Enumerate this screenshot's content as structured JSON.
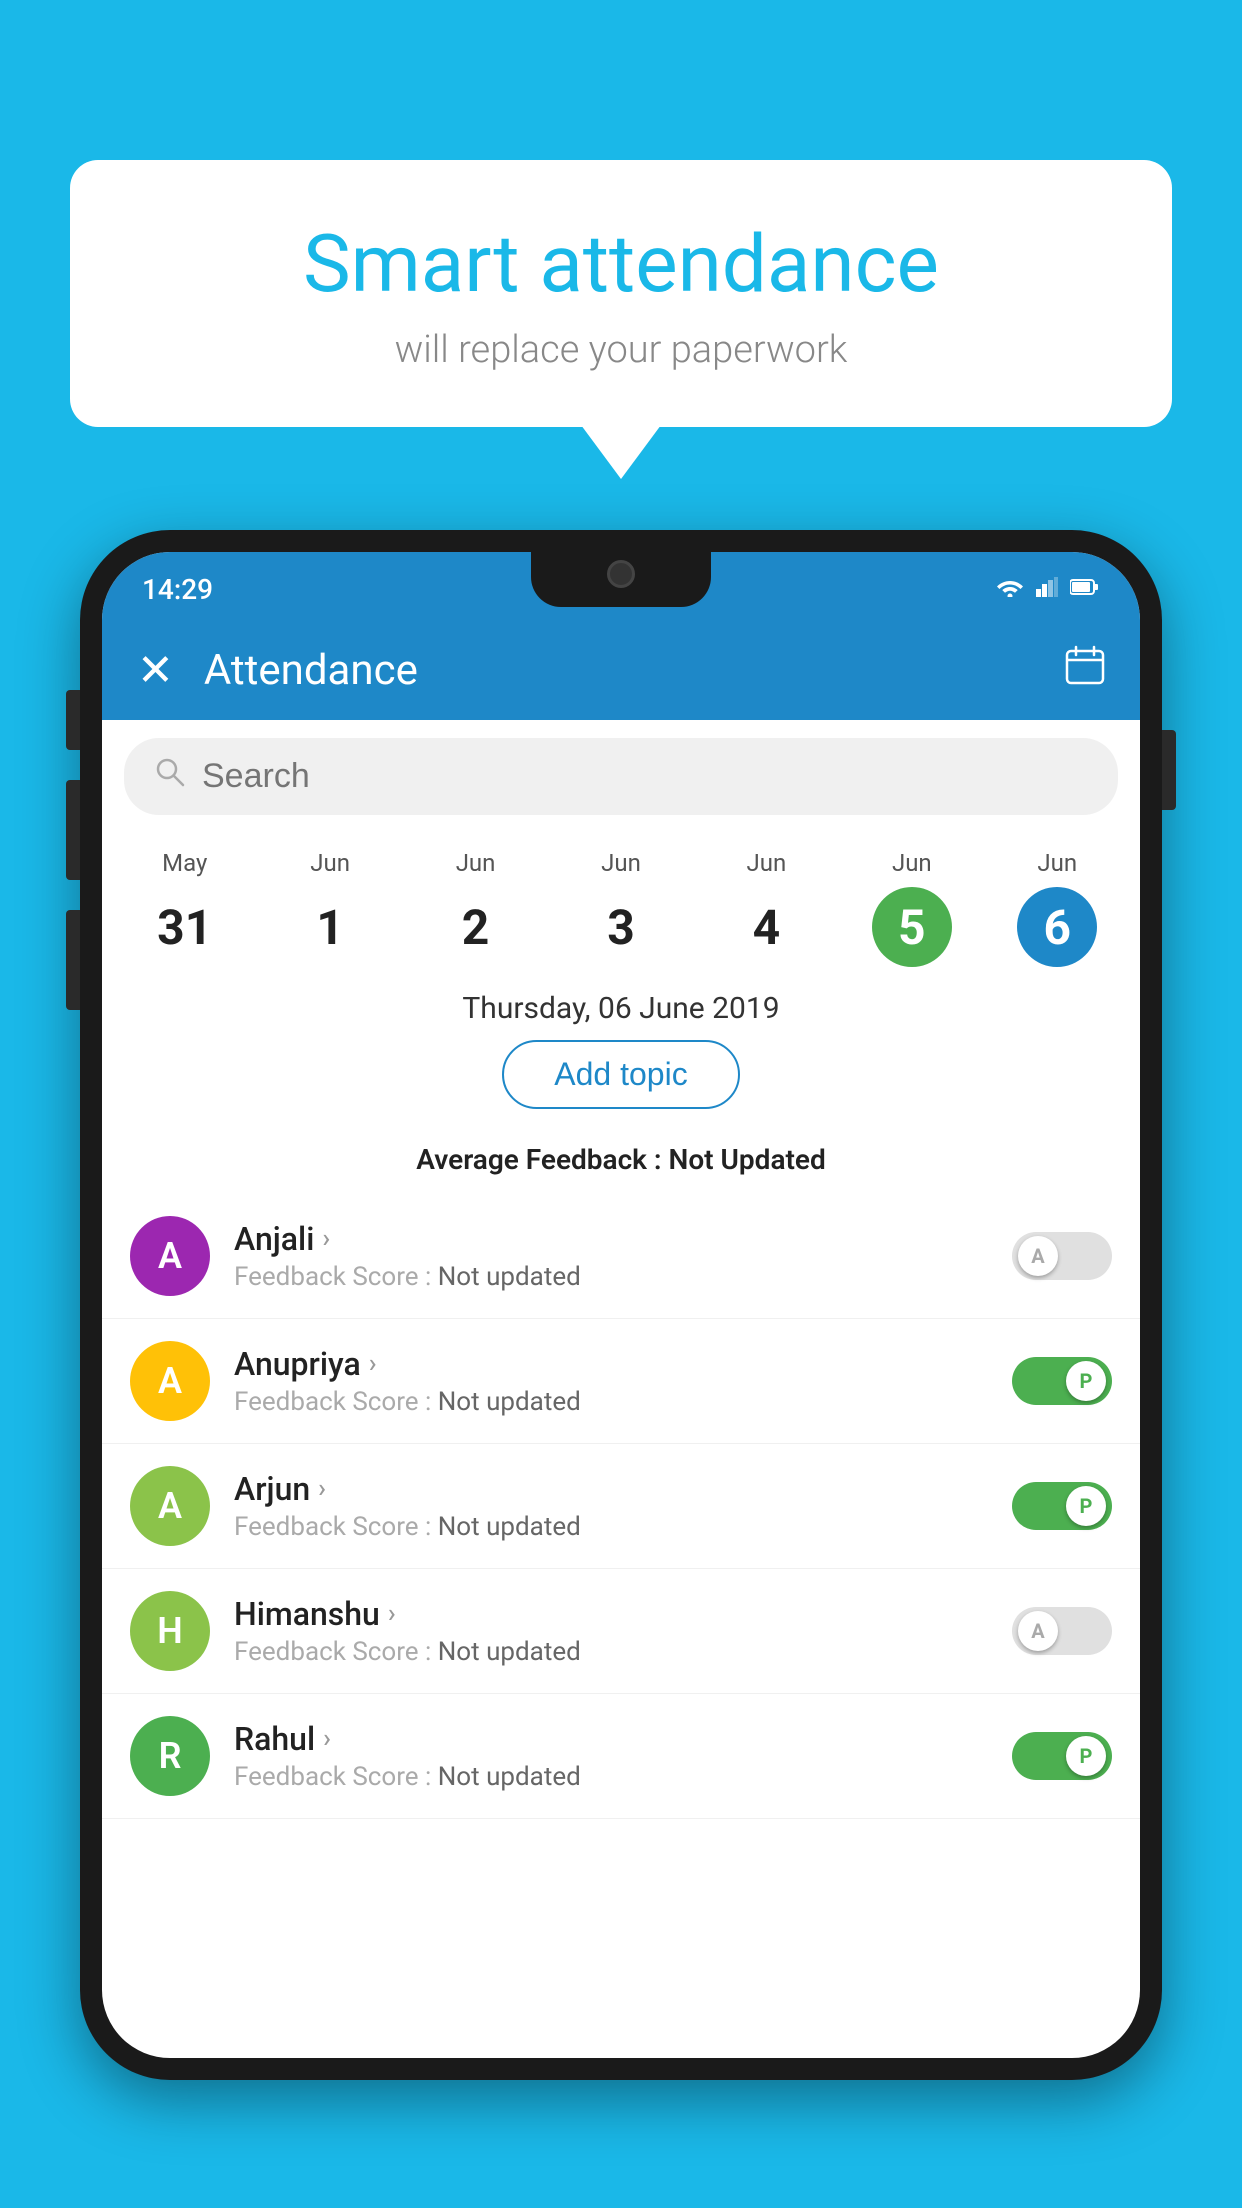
{
  "background_color": "#1ab8e8",
  "speech_bubble": {
    "title": "Smart attendance",
    "subtitle": "will replace your paperwork"
  },
  "status_bar": {
    "time": "14:29",
    "wifi": "▼",
    "signal": "▲",
    "battery": "▌"
  },
  "app_bar": {
    "title": "Attendance",
    "close_label": "✕",
    "calendar_icon": "📅"
  },
  "search": {
    "placeholder": "Search"
  },
  "calendar": {
    "days": [
      {
        "month": "May",
        "date": "31",
        "state": "normal"
      },
      {
        "month": "Jun",
        "date": "1",
        "state": "normal"
      },
      {
        "month": "Jun",
        "date": "2",
        "state": "normal"
      },
      {
        "month": "Jun",
        "date": "3",
        "state": "normal"
      },
      {
        "month": "Jun",
        "date": "4",
        "state": "normal"
      },
      {
        "month": "Jun",
        "date": "5",
        "state": "today"
      },
      {
        "month": "Jun",
        "date": "6",
        "state": "selected"
      }
    ]
  },
  "selected_date": "Thursday, 06 June 2019",
  "add_topic_label": "Add topic",
  "average_feedback": {
    "label": "Average Feedback : ",
    "value": "Not Updated"
  },
  "students": [
    {
      "name": "Anjali",
      "avatar_letter": "A",
      "avatar_color": "#9c27b0",
      "feedback_label": "Feedback Score : ",
      "feedback_value": "Not updated",
      "toggle_state": "off",
      "toggle_label": "A"
    },
    {
      "name": "Anupriya",
      "avatar_letter": "A",
      "avatar_color": "#ffc107",
      "feedback_label": "Feedback Score : ",
      "feedback_value": "Not updated",
      "toggle_state": "on",
      "toggle_label": "P"
    },
    {
      "name": "Arjun",
      "avatar_letter": "A",
      "avatar_color": "#8bc34a",
      "feedback_label": "Feedback Score : ",
      "feedback_value": "Not updated",
      "toggle_state": "on",
      "toggle_label": "P"
    },
    {
      "name": "Himanshu",
      "avatar_letter": "H",
      "avatar_color": "#8bc34a",
      "feedback_label": "Feedback Score : ",
      "feedback_value": "Not updated",
      "toggle_state": "off",
      "toggle_label": "A"
    },
    {
      "name": "Rahul",
      "avatar_letter": "R",
      "avatar_color": "#4caf50",
      "feedback_label": "Feedback Score : ",
      "feedback_value": "Not updated",
      "toggle_state": "on",
      "toggle_label": "P"
    }
  ]
}
